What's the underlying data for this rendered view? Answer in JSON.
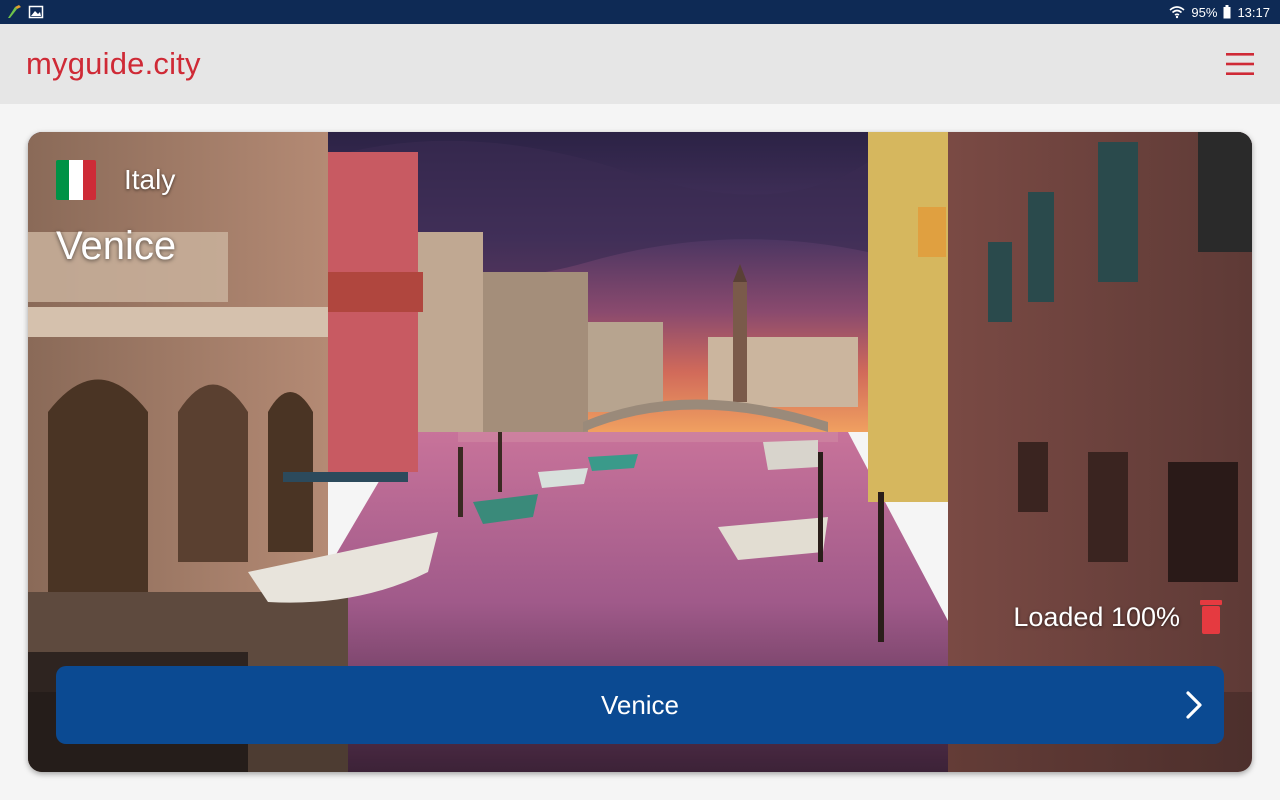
{
  "status_bar": {
    "battery": "95%",
    "time": "13:17",
    "icons": [
      "app-notification-icon",
      "image-notification-icon",
      "wifi-icon",
      "battery-icon"
    ]
  },
  "app_bar": {
    "brand": "myguide.city",
    "brand_color": "#cf2a36",
    "menu_icon": "hamburger-menu-icon"
  },
  "card": {
    "country": "Italy",
    "flag_colors": [
      "#009246",
      "#ffffff",
      "#ce2b37"
    ],
    "city": "Venice",
    "status": "Loaded 100%",
    "delete_icon": "trash-icon",
    "delete_color": "#e53a40",
    "button_label": "Venice",
    "button_color": "#0b4a92",
    "button_icon": "chevron-right-icon"
  }
}
